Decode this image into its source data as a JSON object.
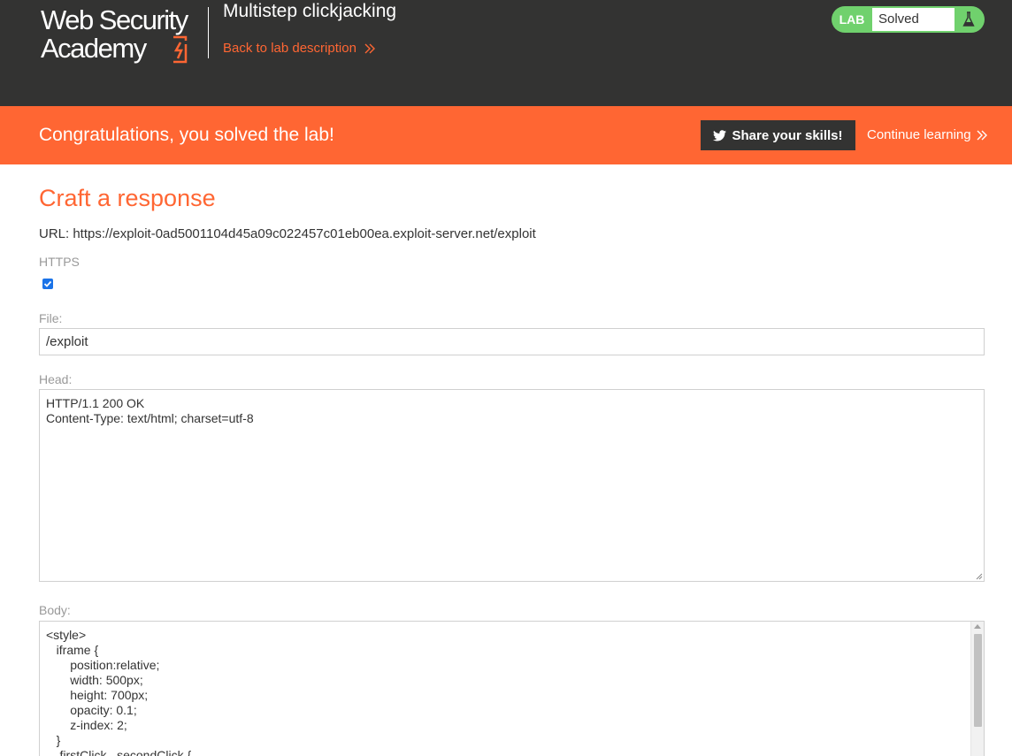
{
  "header": {
    "logo_line1": "Web Security",
    "logo_line2": "Academy",
    "lab_title": "Multistep clickjacking",
    "back_link": "Back to lab description"
  },
  "status": {
    "badge": "LAB",
    "text": "Solved",
    "icon": "flask-icon",
    "color": "#70d16d"
  },
  "banner": {
    "message": "Congratulations, you solved the lab!",
    "share_button": "Share your skills!",
    "share_icon": "twitter-icon",
    "continue_link": "Continue learning"
  },
  "form": {
    "title": "Craft a response",
    "url_label": "URL: https://exploit-0ad5001104d45a09c022457c01eb00ea.exploit-server.net/exploit",
    "https_label": "HTTPS",
    "https_checked": true,
    "file_label": "File:",
    "file_value": "/exploit",
    "head_label": "Head:",
    "head_value": "HTTP/1.1 200 OK\nContent-Type: text/html; charset=utf-8",
    "body_label": "Body:",
    "body_value": "<style>\n   iframe {\n       position:relative;\n       width: 500px;\n       height: 700px;\n       opacity: 0.1;\n       z-index: 2;\n   }\n   .firstClick, .secondClick {"
  },
  "colors": {
    "header_bg": "#333332",
    "accent": "#ff6633",
    "success": "#70d16d"
  }
}
